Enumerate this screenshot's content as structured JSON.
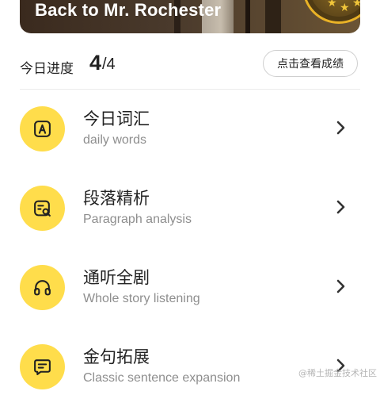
{
  "banner": {
    "title": "Back to Mr. Rochester",
    "badge_icon": "gold-seal-badge-icon",
    "badge_color": "#e9b227"
  },
  "progress": {
    "label": "今日进度",
    "current": "4",
    "total": "/4",
    "score_button_label": "点击查看成绩"
  },
  "modules": [
    {
      "title": "今日词汇",
      "subtitle": "daily words",
      "icon": "letter-a-icon"
    },
    {
      "title": "段落精析",
      "subtitle": "Paragraph analysis",
      "icon": "text-search-icon"
    },
    {
      "title": "通听全剧",
      "subtitle": "Whole story listening",
      "icon": "headphones-icon"
    },
    {
      "title": "金句拓展",
      "subtitle": "Classic sentence expansion",
      "icon": "message-icon"
    }
  ],
  "watermark": "@稀土掘金技术社区",
  "colors": {
    "icon_circle": "#ffdd4b",
    "text_primary": "#222222",
    "text_secondary": "#8e8e8e"
  }
}
